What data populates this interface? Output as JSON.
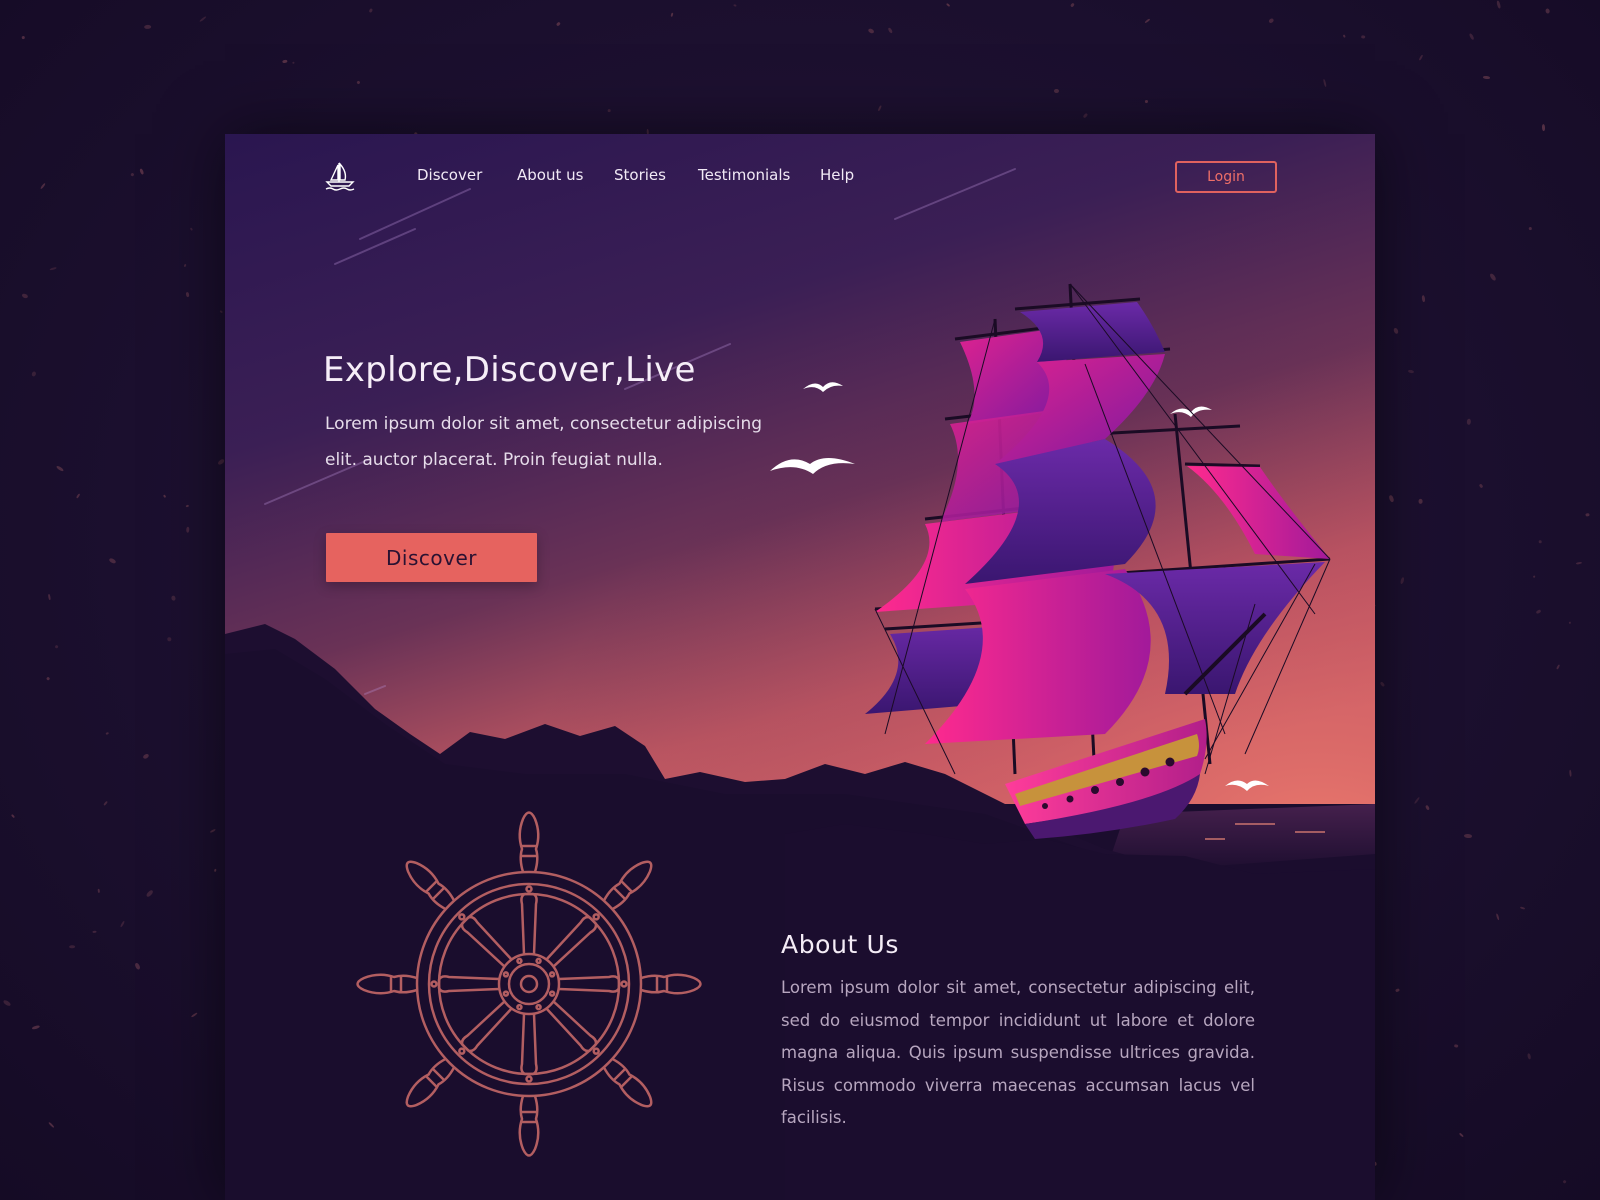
{
  "colors": {
    "background": "#1c1030",
    "page": "#1b0d2e",
    "accent": "#e6635f",
    "sail_pink": "#d81e8a",
    "sail_purple": "#4a1e7a"
  },
  "logo": {
    "icon": "sailboat-icon"
  },
  "nav": {
    "links": [
      "Discover",
      "About us",
      "Stories",
      "Testimonials",
      "Help"
    ],
    "login_label": "Login"
  },
  "hero": {
    "title": "Explore,Discover,Live",
    "text": "Lorem ipsum dolor sit amet, consectetur adipiscing elit. auctor placerat. Proin feugiat nulla.",
    "button_label": "Discover",
    "illustration": "tall-ship-sunset-illustration"
  },
  "about": {
    "title": "About Us",
    "text": "Lorem ipsum dolor sit amet, consectetur adipiscing elit, sed do eiusmod tempor incididunt ut labore et dolore magna aliqua. Quis ipsum suspendisse ultrices gravida. Risus commodo viverra maecenas accumsan lacus vel facilisis.",
    "illustration": "ship-wheel-icon"
  }
}
